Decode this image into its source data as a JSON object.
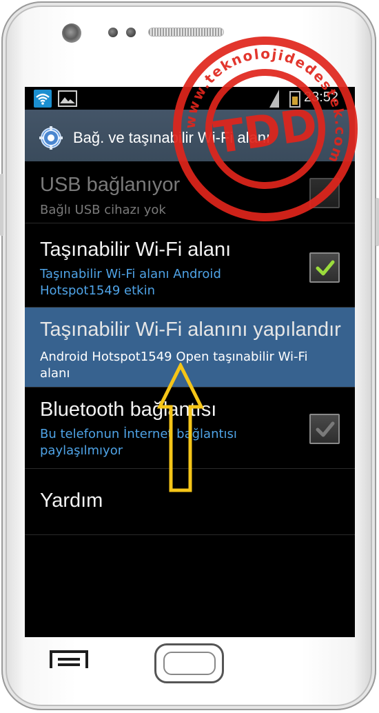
{
  "statusbar": {
    "time": "23:52",
    "icons": [
      "wifi-icon",
      "image-icon",
      "signal-icon",
      "battery-icon"
    ]
  },
  "header": {
    "title": "Bağ. ve taşınabilir Wi-Fi alanı",
    "icon": "gear-icon"
  },
  "settings": {
    "items": [
      {
        "title": "USB bağlanıyor",
        "subtitle": "Bağlı USB cihazı yok",
        "state": "disabled",
        "checked": false
      },
      {
        "title": "Taşınabilir Wi-Fi alanı",
        "subtitle": "Taşınabilir Wi-Fi alanı Android Hotspot1549 etkin",
        "state": "enabled",
        "checked": true
      },
      {
        "title": "Taşınabilir Wi-Fi alanını yapılandır",
        "subtitle": "Android Hotspot1549 Open taşınabilir Wi-Fi alanı",
        "state": "selected"
      },
      {
        "title": "Bluetooth bağlantısı",
        "subtitle": "Bu telefonun İnternet bağlantısı paylaşılmıyor",
        "state": "enabled",
        "checked": false
      },
      {
        "title": "Yardım"
      }
    ]
  },
  "watermark": {
    "logo_text": "TDD",
    "ring_text": "www.teknolojidedestek.com"
  },
  "annotation": {
    "arrow_color": "#f5c518"
  },
  "colors": {
    "accent_blue": "#4fa3e6",
    "selected_row": "#37628f",
    "check_green": "#9bdc3c",
    "stamp_red": "#e0251c"
  }
}
